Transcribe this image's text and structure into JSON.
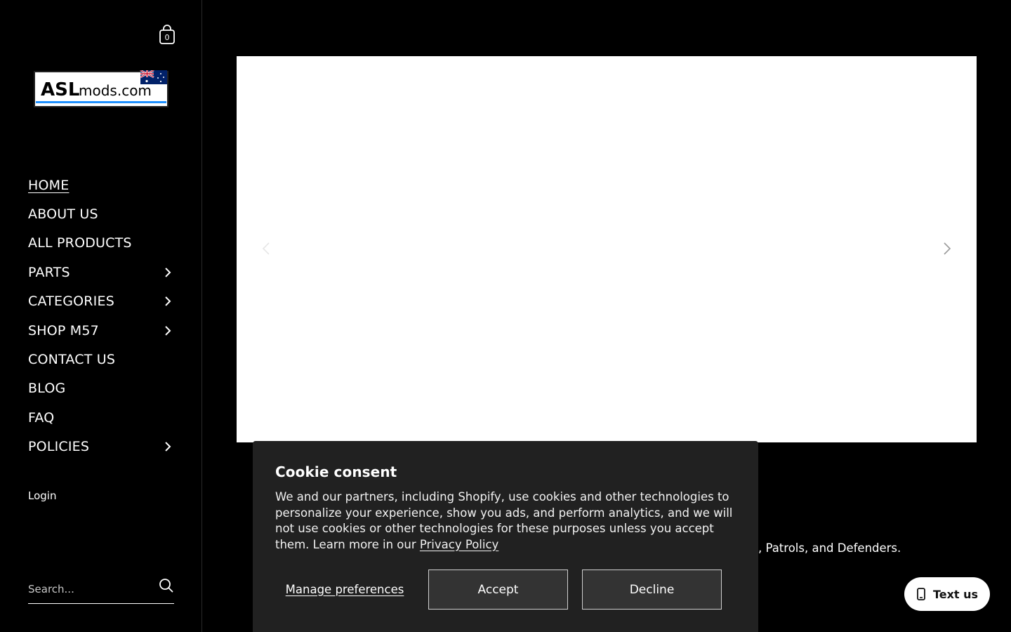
{
  "header": {
    "cart_count": "0",
    "logo": {
      "text_main": "ASL",
      "text_sub": "mods.com"
    }
  },
  "sidebar": {
    "items": [
      {
        "label": "HOME",
        "has_submenu": false,
        "active": true
      },
      {
        "label": "ABOUT US",
        "has_submenu": false
      },
      {
        "label": "ALL PRODUCTS",
        "has_submenu": false
      },
      {
        "label": "PARTS",
        "has_submenu": true
      },
      {
        "label": "CATEGORIES",
        "has_submenu": true
      },
      {
        "label": "SHOP M57",
        "has_submenu": true
      },
      {
        "label": "CONTACT US",
        "has_submenu": false
      },
      {
        "label": "BLOG",
        "has_submenu": false
      },
      {
        "label": "FAQ",
        "has_submenu": false
      },
      {
        "label": "POLICIES",
        "has_submenu": true
      }
    ],
    "login_label": "Login",
    "search_placeholder": "Search..."
  },
  "main": {
    "partial_text": ", Patrols, and Defenders."
  },
  "cookie": {
    "title": "Cookie consent",
    "body": "We and our partners, including Shopify, use cookies and other technologies to personalize your experience, show you ads, and perform analytics, and we will not use cookies or other technologies for these purposes unless you accept them. Learn more in our ",
    "link": "Privacy Policy",
    "manage_label": "Manage preferences",
    "accept_label": "Accept",
    "decline_label": "Decline"
  },
  "chat": {
    "label": "Text us"
  },
  "icons": {
    "cart": "shopping-bag-icon",
    "chevron": "chevron-right-icon",
    "search": "search-icon",
    "prev": "chevron-left-icon",
    "next": "chevron-right-icon",
    "phone": "phone-icon"
  },
  "colors": {
    "background": "#000000",
    "cookie_bg": "#212121",
    "button_bg": "#333333"
  }
}
